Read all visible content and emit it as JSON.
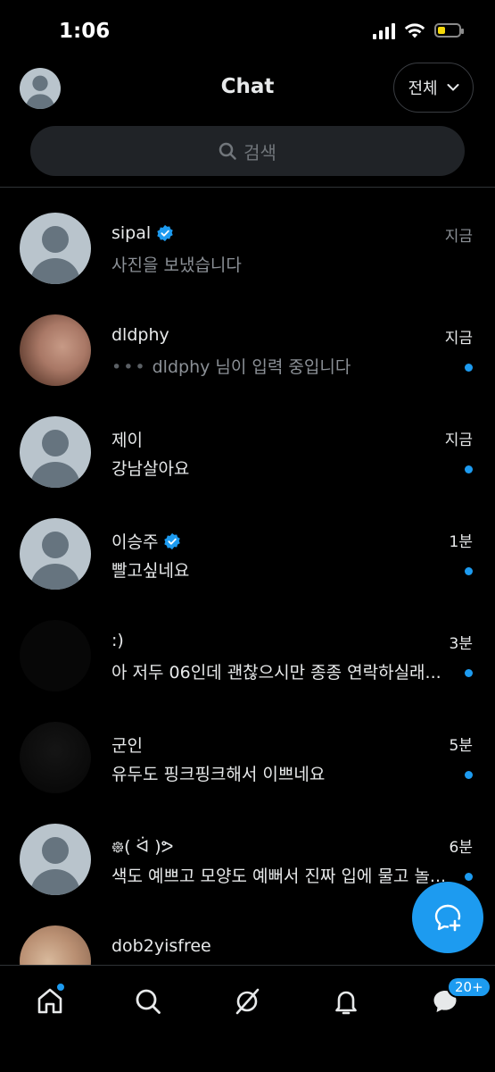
{
  "status_bar": {
    "time": "1:06",
    "battery_color": "#f5d90a"
  },
  "header": {
    "title": "Chat",
    "filter_label": "전체",
    "filter_icon": "chevron-down-icon"
  },
  "search": {
    "placeholder": "검색",
    "icon": "search-icon"
  },
  "chats": [
    {
      "name": "sipal",
      "verified": true,
      "preview": "사진을 보냈습니다",
      "time": "지금",
      "unread": false,
      "typing": false,
      "avatar": "default"
    },
    {
      "name": "dldphy",
      "verified": false,
      "preview": "dldphy 님이 입력 중입니다",
      "time": "지금",
      "unread": true,
      "typing": true,
      "avatar": "photo-skin"
    },
    {
      "name": "제이",
      "verified": false,
      "preview": "강남살아요",
      "time": "지금",
      "unread": true,
      "typing": false,
      "avatar": "default"
    },
    {
      "name": "이승주",
      "verified": true,
      "preview": "빨고싶네요",
      "time": "1분",
      "unread": true,
      "typing": false,
      "avatar": "default"
    },
    {
      "name": ":)",
      "verified": false,
      "preview": "아 저두 06인데 괜찮으시만 종종 연락하실래...",
      "time": "3분",
      "unread": true,
      "typing": false,
      "avatar": "photo-dark"
    },
    {
      "name": "군인",
      "verified": false,
      "preview": "유두도 핑크핑크해서 이쁘네요",
      "time": "5분",
      "unread": true,
      "typing": false,
      "avatar": "photo-dark2"
    },
    {
      "name": "᪥( ᐛ )ᕗ",
      "verified": false,
      "preview": "색도 예쁘고 모양도 예뻐서 진짜 입에 물고 놀...",
      "time": "6분",
      "unread": true,
      "typing": false,
      "avatar": "default"
    },
    {
      "name": "dob2yisfree",
      "verified": false,
      "preview": "",
      "time": "",
      "unread": false,
      "typing": false,
      "avatar": "photo-beige"
    }
  ],
  "fab": {
    "icon": "new-message-icon",
    "color": "#1d9bf0"
  },
  "bottom_nav": {
    "items": [
      {
        "name": "home-icon",
        "has_dot": true
      },
      {
        "name": "explore-icon"
      },
      {
        "name": "grok-icon"
      },
      {
        "name": "notifications-icon"
      },
      {
        "name": "messages-icon",
        "badge": "20+"
      }
    ]
  },
  "colors": {
    "accent": "#1d9bf0",
    "background": "#000000",
    "text": "#e7e9ea",
    "muted": "#8b9096"
  }
}
